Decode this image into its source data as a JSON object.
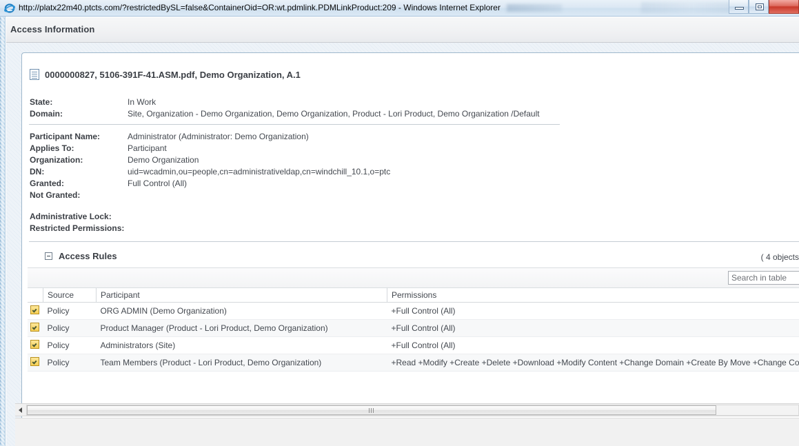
{
  "window": {
    "title": "http://platx22m40.ptcts.com/?restrictedBySL=false&ContainerOid=OR:wt.pdmlink.PDMLinkProduct:209 - Windows Internet Explorer",
    "browser_icon": "internet-explorer-icon",
    "controls": {
      "minimize": "minimize-icon",
      "restore": "restore-icon",
      "close": "close-icon"
    }
  },
  "header": {
    "title": "Access Information"
  },
  "object": {
    "icon": "document-icon",
    "title": "0000000827, 5106-391F-41.ASM.pdf, Demo Organization, A.1"
  },
  "attributes_top": [
    {
      "label": "State:",
      "value": "In Work"
    },
    {
      "label": "Domain:",
      "value": "Site, Organization - Demo Organization, Demo Organization, Product - Lori Product, Demo Organization /Default"
    }
  ],
  "attributes_participant": [
    {
      "label": "Participant Name:",
      "value": "Administrator (Administrator: Demo Organization)"
    },
    {
      "label": "Applies To:",
      "value": "Participant"
    },
    {
      "label": "Organization:",
      "value": "Demo Organization"
    },
    {
      "label": "DN:",
      "value": "uid=wcadmin,ou=people,cn=administrativeldap,cn=windchill_10.1,o=ptc"
    },
    {
      "label": "Granted:",
      "value": "Full Control (All)"
    },
    {
      "label": "Not Granted:",
      "value": ""
    }
  ],
  "attributes_lock": [
    {
      "label": "Administrative Lock:",
      "value": ""
    },
    {
      "label": "Restricted Permissions:",
      "value": ""
    }
  ],
  "access_rules": {
    "section_title": "Access Rules",
    "collapse_icon": "collapse-minus-icon",
    "object_count": "( 4 objects",
    "search": {
      "placeholder": "Search in table",
      "value": "",
      "icon": "search-icon"
    },
    "columns": [
      "",
      "Source",
      "Participant",
      "Permissions"
    ],
    "rows": [
      {
        "icon": "policy-rule-icon",
        "source": "Policy",
        "participant": "ORG ADMIN (Demo Organization)",
        "permissions": "+Full Control (All)"
      },
      {
        "icon": "policy-rule-icon",
        "source": "Policy",
        "participant": "Product Manager (Product - Lori Product, Demo Organization)",
        "permissions": "+Full Control (All)"
      },
      {
        "icon": "policy-rule-icon",
        "source": "Policy",
        "participant": "Administrators (Site)",
        "permissions": "+Full Control (All)"
      },
      {
        "icon": "policy-rule-icon",
        "source": "Policy",
        "participant": "Team Members (Product - Lori Product, Demo Organization)",
        "permissions": "+Read +Modify +Create +Delete +Download +Modify Content +Change Domain +Create By Move +Change Context"
      }
    ]
  },
  "scrollbar": {
    "left_arrow_icon": "scroll-left-arrow-icon",
    "grip_icon": "scroll-thumb-grip-icon"
  },
  "colors": {
    "accent": "#9fb8cc",
    "header_text": "#3b3f45",
    "policy_icon": "#f6cf55",
    "close_button": "#c9392b"
  }
}
